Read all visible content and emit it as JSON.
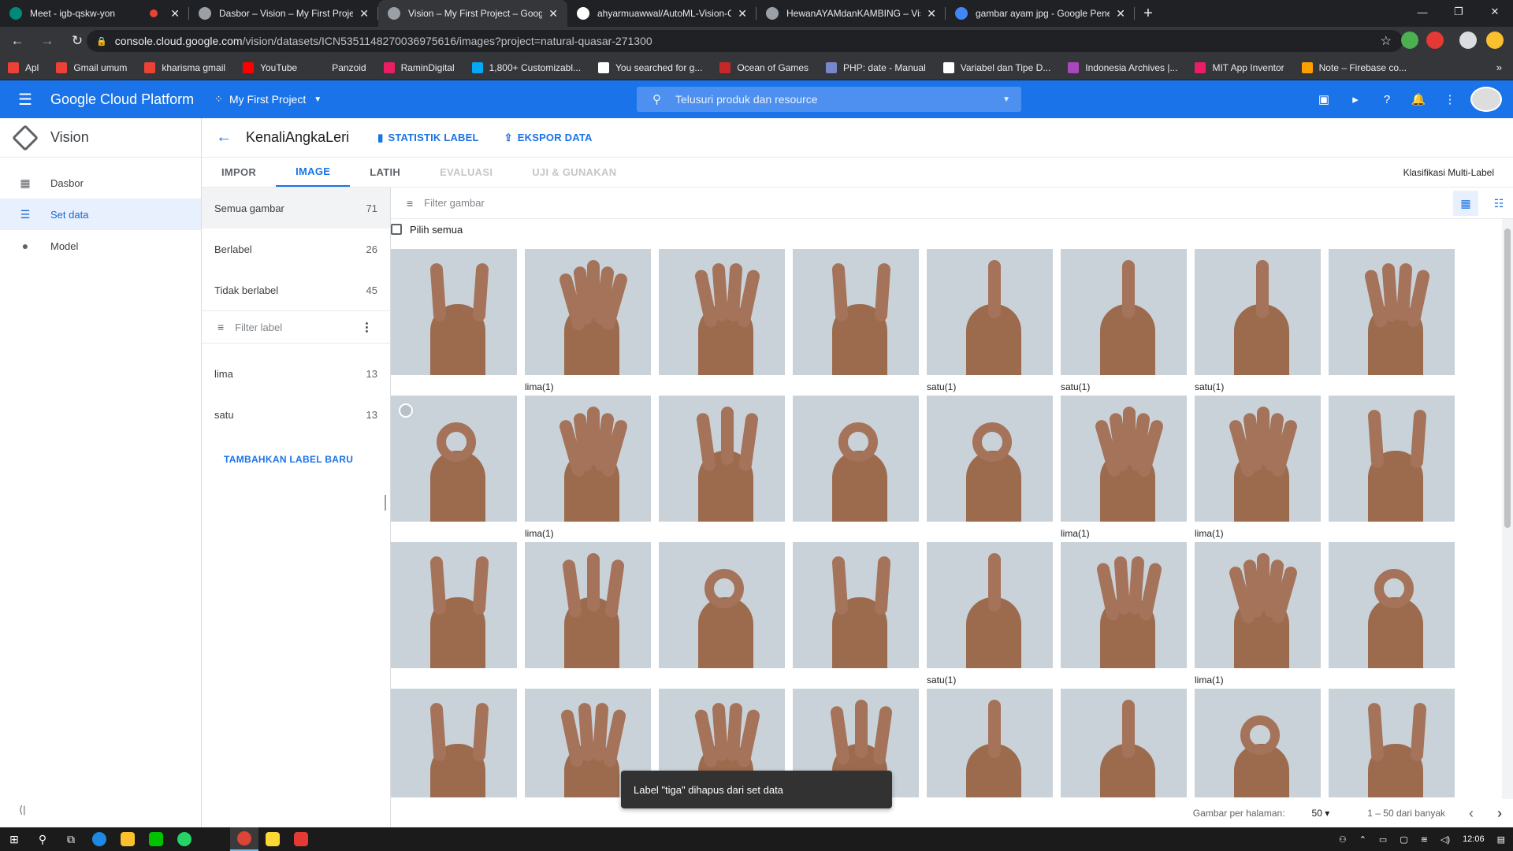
{
  "browser": {
    "tabs": [
      {
        "label": "Meet - igb-qskw-yon",
        "favicon_color": "#00897b",
        "recording": true
      },
      {
        "label": "Dasbor – Vision – My First Projec",
        "favicon_color": "#9aa0a6"
      },
      {
        "label": "Vision – My First Project – Googl",
        "favicon_color": "#9aa0a6",
        "active": true
      },
      {
        "label": "ahyarmuawwal/AutoML-Vision-C",
        "favicon_color": "#ffffff"
      },
      {
        "label": "HewanAYAMdanKAMBING – Visi",
        "favicon_color": "#9aa0a6"
      },
      {
        "label": "gambar ayam jpg - Google Pene",
        "favicon_color": "#4285f4"
      }
    ],
    "url_host": "console.cloud.google.com",
    "url_path": "/vision/datasets/ICN5351148270036975616/images?project=natural-quasar-271300",
    "bookmarks": [
      {
        "label": "Apl",
        "color": "#ea4335"
      },
      {
        "label": "Gmail umum",
        "color": "#ea4335"
      },
      {
        "label": "kharisma gmail",
        "color": "#ea4335"
      },
      {
        "label": "YouTube",
        "color": "#ff0000"
      },
      {
        "label": "Panzoid",
        "color": "#35363a"
      },
      {
        "label": "RaminDigital",
        "color": "#e91e63"
      },
      {
        "label": "1,800+ Customizabl...",
        "color": "#03a9f4"
      },
      {
        "label": "You searched for g...",
        "color": "#ffffff"
      },
      {
        "label": "Ocean of Games",
        "color": "#c62828"
      },
      {
        "label": "PHP: date - Manual",
        "color": "#7986cb"
      },
      {
        "label": "Variabel dan Tipe D...",
        "color": "#ffffff"
      },
      {
        "label": "Indonesia Archives |...",
        "color": "#ab47bc"
      },
      {
        "label": "MIT App Inventor",
        "color": "#e91e63"
      },
      {
        "label": "Note – Firebase co...",
        "color": "#ffa000"
      }
    ]
  },
  "header": {
    "product": "Google Cloud Platform",
    "project": "My First Project",
    "search_placeholder": "Telusuri produk dan resource"
  },
  "leftnav": {
    "title": "Vision",
    "items": [
      {
        "label": "Dasbor",
        "icon": "dashboard-icon",
        "glyph": "▦"
      },
      {
        "label": "Set data",
        "icon": "list-icon",
        "glyph": "☰",
        "active": true
      },
      {
        "label": "Model",
        "icon": "bulb-icon",
        "glyph": "●"
      }
    ]
  },
  "dataset": {
    "name": "KenaliAngkaLeri",
    "actions": {
      "stats": "STATISTIK LABEL",
      "export": "EKSPOR DATA"
    },
    "tabs": [
      {
        "label": "IMPOR",
        "state": "normal"
      },
      {
        "label": "IMAGE",
        "state": "active"
      },
      {
        "label": "LATIH",
        "state": "normal"
      },
      {
        "label": "EVALUASI",
        "state": "disabled"
      },
      {
        "label": "UJI & GUNAKAN",
        "state": "disabled"
      }
    ],
    "type_badge": "Klasifikasi Multi-Label",
    "groups": [
      {
        "label": "Semua gambar",
        "count": "71",
        "active": true
      },
      {
        "label": "Berlabel",
        "count": "26"
      },
      {
        "label": "Tidak berlabel",
        "count": "45"
      }
    ],
    "filter_label_placeholder": "Filter label",
    "labels": [
      {
        "label": "lima",
        "count": "13"
      },
      {
        "label": "satu",
        "count": "13"
      }
    ],
    "add_label": "TAMBAHKAN LABEL BARU"
  },
  "images": {
    "filter_placeholder": "Filter gambar",
    "select_all": "Pilih semua",
    "rows": [
      [
        {
          "fingers": 2,
          "caption": ""
        },
        {
          "fingers": 5,
          "caption": "lima(1)"
        },
        {
          "fingers": 4,
          "caption": ""
        },
        {
          "fingers": 2,
          "caption": ""
        },
        {
          "fingers": 1,
          "caption": "satu(1)"
        },
        {
          "fingers": 1,
          "caption": "satu(1)"
        },
        {
          "fingers": 1,
          "caption": "satu(1)"
        },
        {
          "fingers": 4,
          "caption": ""
        }
      ],
      [
        {
          "fingers": 0,
          "caption": ""
        },
        {
          "fingers": 5,
          "caption": "lima(1)"
        },
        {
          "fingers": 3,
          "caption": ""
        },
        {
          "fingers": 0,
          "caption": ""
        },
        {
          "fingers": 0,
          "caption": ""
        },
        {
          "fingers": 5,
          "caption": "lima(1)"
        },
        {
          "fingers": 5,
          "caption": "lima(1)"
        },
        {
          "fingers": 2,
          "caption": ""
        }
      ],
      [
        {
          "fingers": 2,
          "caption": ""
        },
        {
          "fingers": 3,
          "caption": ""
        },
        {
          "fingers": 0,
          "caption": ""
        },
        {
          "fingers": 2,
          "caption": ""
        },
        {
          "fingers": 1,
          "caption": "satu(1)"
        },
        {
          "fingers": 4,
          "caption": ""
        },
        {
          "fingers": 5,
          "caption": "lima(1)"
        },
        {
          "fingers": 0,
          "caption": ""
        }
      ],
      [
        {
          "fingers": 2,
          "caption": ""
        },
        {
          "fingers": 4,
          "caption": ""
        },
        {
          "fingers": 4,
          "caption": ""
        },
        {
          "fingers": 3,
          "caption": ""
        },
        {
          "fingers": 1,
          "caption": ""
        },
        {
          "fingers": 1,
          "caption": ""
        },
        {
          "fingers": 0,
          "caption": ""
        },
        {
          "fingers": 2,
          "caption": ""
        }
      ]
    ],
    "per_page_label": "Gambar per halaman:",
    "per_page_value": "50",
    "range": "1 – 50 dari banyak"
  },
  "toast": "Label \"tiga\" dihapus dari set data",
  "taskbar": {
    "time": "12:06"
  }
}
